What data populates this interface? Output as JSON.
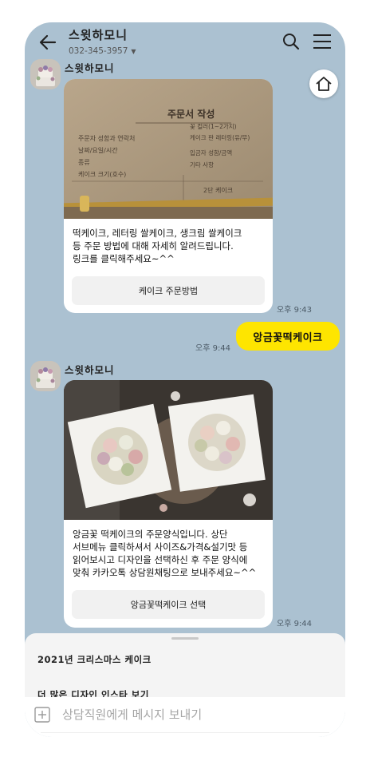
{
  "header": {
    "title": "스윗하모니",
    "subtitle": "032-345-3957",
    "back_icon": "back-arrow-icon",
    "search_icon": "search-icon",
    "menu_icon": "hamburger-menu-icon"
  },
  "home_button": {
    "icon": "home-icon"
  },
  "messages": [
    {
      "sender": "스윗하모니",
      "image": "order-form-photo",
      "text": "떡케이크, 레터링 쌀케이크, 생크림 쌀케이크\n등 주문 방법에 대해 자세히 알려드립니다.\n링크를 클릭해주세요~^^",
      "button_label": "케이크 주문방법",
      "time": "오후 9:43",
      "image_texts": [
        "주문서 작성",
        "주문자 성함과 연락처",
        "날짜/요일/시간",
        "종류",
        "케이크 크기(호수)",
        "꽃 컬러(1~2가지)",
        "케이크 판 레터링(유/무)",
        "입금자 성함/금액",
        "기타 사항",
        "2단 케이크"
      ]
    },
    {
      "sender": "me",
      "text": "앙금꽃떡케이크",
      "time": "오후 9:44"
    },
    {
      "sender": "스윗하모니",
      "image": "flower-rice-cakes-photo",
      "text": "앙금꽃 떡케이크의 주문양식입니다. 상단\n서브메뉴 클릭하셔서 사이즈&가격&설기맛 등\n읽어보시고 디자인을 선택하신 후 주문 양식에\n맞춰 카카오톡 상담원채팅으로 보내주세요~^^",
      "button_label": "앙금꽃떡케이크 선택",
      "time": "오후 9:44"
    }
  ],
  "bottom_menu": {
    "items": [
      "2021년 크리스마스 케이크",
      "더 많은 디자인 인스타 보기"
    ]
  },
  "input": {
    "placeholder": "상담직원에게 메시지 보내기",
    "plus_icon": "plus-square-icon"
  },
  "colors": {
    "chat_background": "#abc1d1",
    "my_bubble": "#fee500",
    "card_background": "#ffffff"
  }
}
